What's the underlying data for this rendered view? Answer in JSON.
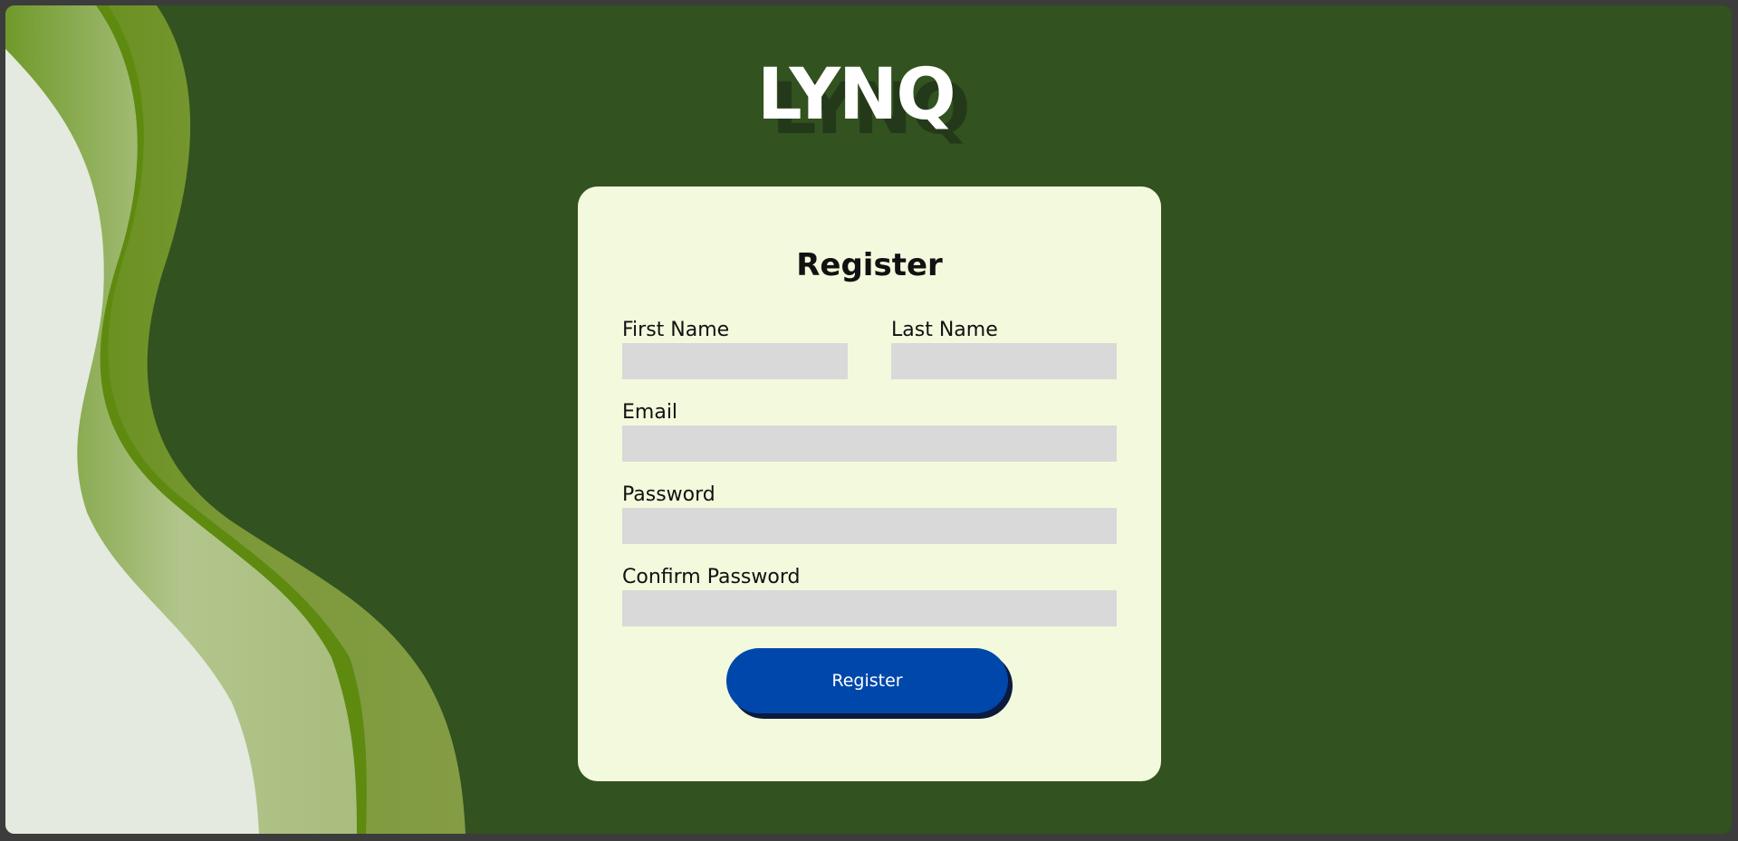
{
  "brand": {
    "logo_text": "LYNQ"
  },
  "form": {
    "title": "Register",
    "fields": {
      "first_name": {
        "label": "First Name",
        "value": "",
        "placeholder": ""
      },
      "last_name": {
        "label": "Last Name",
        "value": "",
        "placeholder": ""
      },
      "email": {
        "label": "Email",
        "value": "",
        "placeholder": ""
      },
      "password": {
        "label": "Password",
        "value": "",
        "placeholder": ""
      },
      "confirm_password": {
        "label": "Confirm Password",
        "value": "",
        "placeholder": ""
      }
    },
    "submit_label": "Register"
  },
  "colors": {
    "background": "#325220",
    "card": "#f3f9dc",
    "input": "#d9d9d9",
    "button": "#0047ab",
    "button_shadow": "#0b1a3d",
    "wave_light": "#e4eadf",
    "wave_pale_green": "#b2c58c",
    "wave_green": "#5e8a10",
    "wave_olive": "#849c44"
  }
}
